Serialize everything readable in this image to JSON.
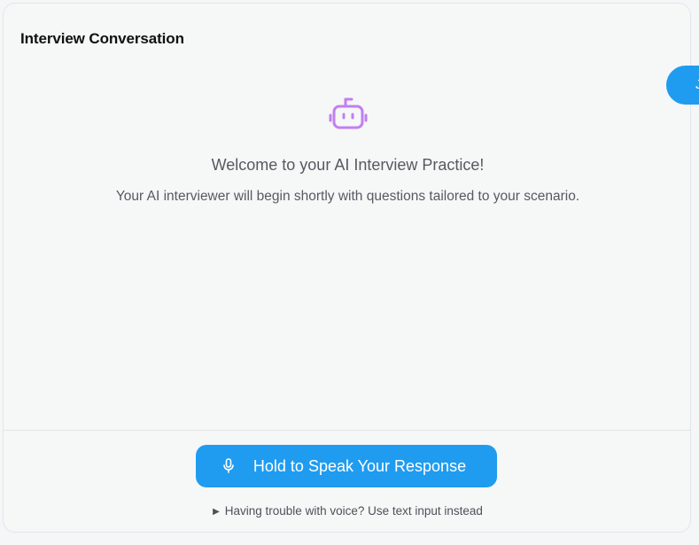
{
  "conversation": {
    "title": "Interview Conversation",
    "welcome_title": "Welcome to your AI Interview Practice!",
    "welcome_subtitle": "Your AI interviewer will begin shortly with questions tailored to your scenario.",
    "bot_icon": "robot-icon",
    "accent_color": "#c17ff0"
  },
  "controls": {
    "speak_button_label": "Hold to Speak Your Response",
    "mic_icon": "microphone-icon",
    "fallback_toggle_label": "Having trouble with voice? Use text input instead",
    "fallback_toggle_icon": "▶",
    "button_color": "#1f9cf0"
  },
  "side_tab": {
    "glyph": "J"
  }
}
